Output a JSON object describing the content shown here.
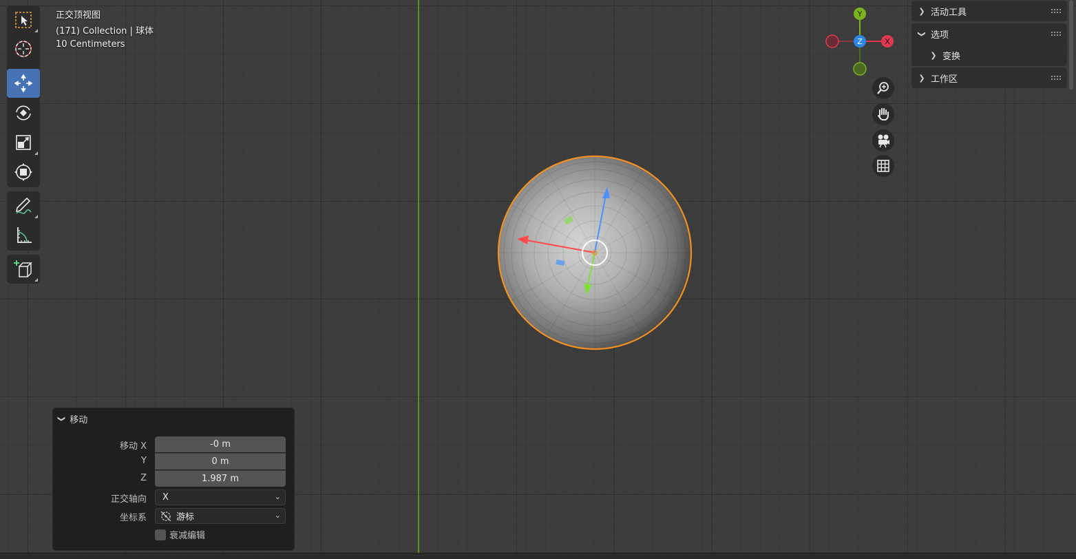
{
  "viewport": {
    "view_name": "正交顶视图",
    "collection_line": "(171) Collection | 球体",
    "scale_line": "10 Centimeters"
  },
  "toolbar": {
    "tools": [
      {
        "name": "select-box",
        "icon": "select-box-icon",
        "active": false
      },
      {
        "name": "cursor",
        "icon": "cursor-icon",
        "active": false
      },
      {
        "name": "move",
        "icon": "move-icon",
        "active": true
      },
      {
        "name": "rotate",
        "icon": "rotate-icon",
        "active": false
      },
      {
        "name": "scale",
        "icon": "scale-icon",
        "active": false
      },
      {
        "name": "transform",
        "icon": "transform-icon",
        "active": false
      },
      {
        "name": "annotate",
        "icon": "annotate-icon",
        "active": false
      },
      {
        "name": "measure",
        "icon": "measure-icon",
        "active": false
      },
      {
        "name": "add-cube",
        "icon": "add-cube-icon",
        "active": false
      }
    ]
  },
  "gizmo": {
    "y_label": "Y",
    "z_label": "Z",
    "x_label": "X",
    "colors": {
      "x": "#e0384e",
      "y": "#7ab321",
      "z": "#2e86e6"
    }
  },
  "nav_buttons": [
    "zoom-icon",
    "pan-hand-icon",
    "camera-icon",
    "grid-icon"
  ],
  "sidebar": {
    "panels": [
      {
        "label": "活动工具",
        "expanded": false
      },
      {
        "label": "选项",
        "expanded": true,
        "children": [
          {
            "label": "变换",
            "expanded": false
          }
        ]
      },
      {
        "label": "工作区",
        "expanded": false
      }
    ]
  },
  "operator": {
    "title": "移动",
    "move_x_label": "移动 X",
    "move_x_value": "-0 m",
    "y_label": "Y",
    "y_value": "0 m",
    "z_label": "Z",
    "z_value": "1.987 m",
    "orient_label": "正交轴向",
    "orient_value": "X",
    "coord_label": "坐标系",
    "coord_value": "游标",
    "falloff_label": "衰减编辑"
  },
  "colors": {
    "accent": "#4772b3",
    "selection_outline": "#f3901f",
    "y_axis_line": "#5f8f1e"
  }
}
